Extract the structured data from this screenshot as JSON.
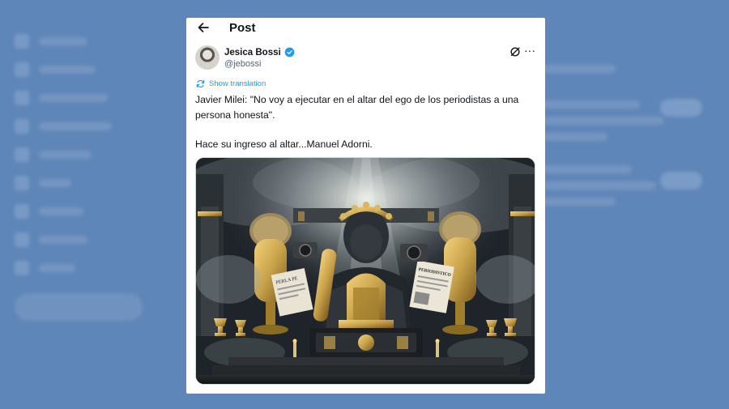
{
  "header": {
    "title": "Post"
  },
  "author": {
    "name": "Jesica Bossi",
    "handle": "@jebossi"
  },
  "translation": {
    "label": "Show translation"
  },
  "tweet": {
    "line1": "Javier Milei: \"No voy a ejecutar en el altar del ego de los periodistas a una persona honesta\".",
    "line2": "Hace su ingreso al altar...Manuel Adorni."
  },
  "media": {
    "newspaper_text": "PERIODISTICO",
    "newspaper_text_left": "PERLA PE",
    "accent_gold": "#c8a24a"
  },
  "colors": {
    "background": "#5f86b8",
    "link": "#1d9bf0",
    "verified": "#1d9bf0"
  }
}
